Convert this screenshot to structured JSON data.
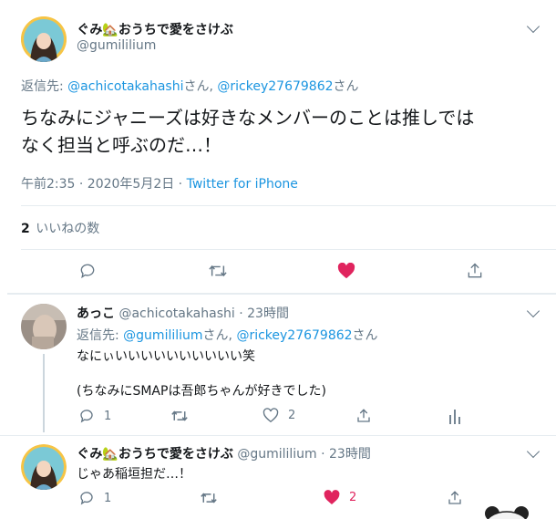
{
  "main_tweet": {
    "display_name": "ぐみ🏡おうちで愛をさけぶ",
    "handle": "@gumililium",
    "reply_label": "返信先:",
    "reply_to_1": "@achicotakahashi",
    "reply_san_1": "さん,",
    "reply_to_2": "@rickey27679862",
    "reply_san_2": "さん",
    "text_line1": "ちなみにジャニーズは好きなメンバーのことは推しでは",
    "text_line2": "なく担当と呼ぶのだ…！",
    "timestamp": "午前2:35 · 2020年5月2日 · ",
    "source": "Twitter for iPhone",
    "likes_count": "2",
    "likes_label": "いいねの数",
    "liked": true
  },
  "reply1": {
    "display_name": "あっこ",
    "handle": "@achicotakahashi",
    "time": "· 23時間",
    "reply_label": "返信先:",
    "reply_to_1": "@gumililium",
    "reply_san_1": "さん,",
    "reply_to_2": "@rickey27679862",
    "reply_san_2": "さん",
    "text_line1": "なにぃいいいいいいいいいい笑",
    "text_line2": "(ちなみにSMAPは吾郎ちゃんが好きでした)",
    "reply_count": "1",
    "like_count": "2"
  },
  "reply2": {
    "display_name": "ぐみ🏡おうちで愛をさけぶ",
    "handle": "@gumililium",
    "time": "· 23時間",
    "text": "じゃあ稲垣担だ…！",
    "reply_count": "1",
    "like_count": "2",
    "liked": true
  },
  "colors": {
    "link": "#1b95e0",
    "muted": "#657786",
    "like": "#e0245e",
    "divider": "#e6ecf0"
  }
}
